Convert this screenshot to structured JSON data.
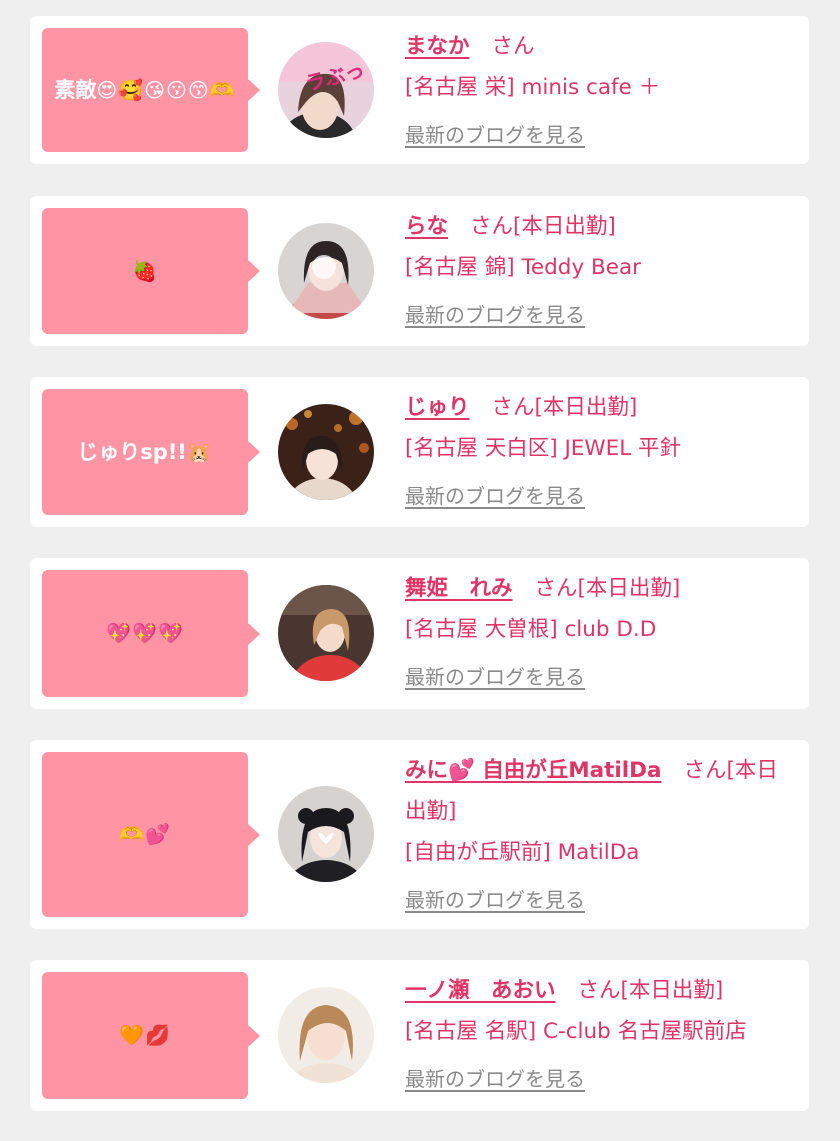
{
  "entries": [
    {
      "message": "素敵",
      "emojis": "😍🥰😘😗😙🫶",
      "name": "まなか",
      "honorific": "さん",
      "status": "",
      "shop": "[名古屋 栄] minis cafe ＋",
      "blog_link": "最新のブログを見る",
      "avatar_icon": "avatar-girl-1"
    },
    {
      "message": "",
      "emojis": "🍓",
      "name": "らな",
      "honorific": "さん",
      "status": "[本日出勤]",
      "shop": "[名古屋 錦] Teddy Bear",
      "blog_link": "最新のブログを見る",
      "avatar_icon": "avatar-girl-2"
    },
    {
      "message": "じゅりsp!!",
      "emojis": "🐹",
      "name": "じゅり",
      "honorific": "さん",
      "status": "[本日出勤]",
      "shop": "[名古屋 天白区] JEWEL 平針",
      "blog_link": "最新のブログを見る",
      "avatar_icon": "avatar-girl-3"
    },
    {
      "message": "",
      "emojis": "💖💖💖",
      "name": "舞姫　れみ",
      "honorific": "さん",
      "status": "[本日出勤]",
      "shop": "[名古屋 大曽根] club D.D",
      "blog_link": "最新のブログを見る",
      "avatar_icon": "avatar-girl-4"
    },
    {
      "message": "",
      "emojis": "🫶💕",
      "name": "みに💕 自由が丘MatilDa",
      "honorific": "さん",
      "status": "[本日出勤]",
      "shop": "[自由が丘駅前] MatilDa",
      "blog_link": "最新のブログを見る",
      "avatar_icon": "avatar-girl-5"
    },
    {
      "message": "",
      "emojis": "🧡💋",
      "name": "一ノ瀬　あおい",
      "honorific": "さん",
      "status": "[本日出勤]",
      "shop": "[名古屋 名駅] C-club 名古屋駅前店",
      "blog_link": "最新のブログを見る",
      "avatar_icon": "avatar-girl-6"
    }
  ],
  "colors": {
    "accent": "#e03466",
    "bubble": "#ff94a4",
    "link_gray": "#8a8a8a",
    "background": "#efefef"
  }
}
